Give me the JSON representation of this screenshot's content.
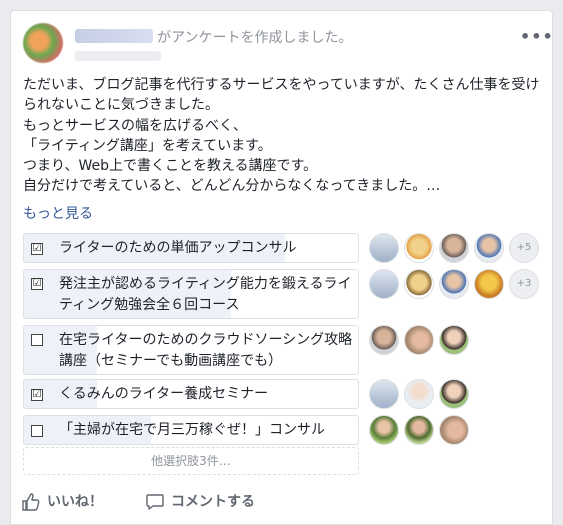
{
  "post": {
    "action_text": "がアンケートを作成しました。",
    "more_menu": "•••",
    "body": "ただいま、ブログ記事を代行するサービスをやっていますが、たくさん仕事を受けられないことに気づきました。\nもっとサービスの幅を広げるべく、\n「ライティング講座」を考えています。\nつまり、Web上で書くことを教える講座です。\n自分だけで考えていると、どんどん分からなくなってきました。…",
    "see_more": "もっと見る"
  },
  "poll": {
    "options": [
      {
        "label": "ライターのための単価アップコンサル",
        "checked": true,
        "check_glyph": "☑",
        "vote_share": 0.78,
        "extra_voters": "+5"
      },
      {
        "label": "発注主が認めるライティング能力を鍛えるライティング勉強会全６回コース",
        "checked": true,
        "check_glyph": "☑",
        "vote_share": 0.62,
        "extra_voters": "+3"
      },
      {
        "label": "在宅ライターのためのクラウドソーシング攻略講座（セミナーでも動画講座でも）",
        "checked": false,
        "check_glyph": "",
        "vote_share": 0.22,
        "extra_voters": ""
      },
      {
        "label": "くるみんのライター養成セミナー",
        "checked": true,
        "check_glyph": "☑",
        "vote_share": 0.22,
        "extra_voters": ""
      },
      {
        "label": "「主婦が在宅で月三万稼ぐぜ！」コンサル",
        "checked": false,
        "check_glyph": "",
        "vote_share": 0.38,
        "extra_voters": ""
      }
    ],
    "more_options": "他選択肢3件…"
  },
  "footer": {
    "like_label": "いいね！",
    "comment_label": "コメントする"
  },
  "colors": {
    "link": "#385898",
    "meta": "#90949c",
    "fill": "#eef1f7"
  }
}
